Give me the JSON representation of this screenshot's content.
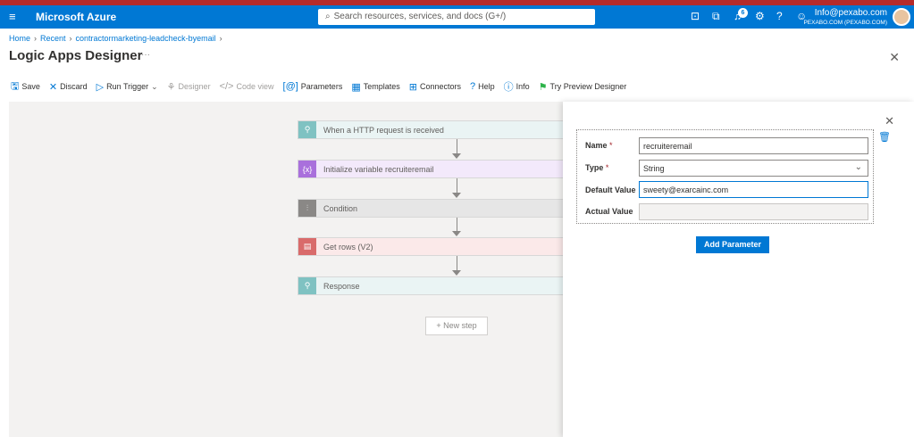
{
  "header": {
    "brand": "Microsoft Azure",
    "search_placeholder": "Search resources, services, and docs (G+/)",
    "notification_count": "6",
    "user_email": "Info@pexabo.com",
    "user_org": "PEXABO.COM (PEXABO.COM)"
  },
  "breadcrumb": {
    "items": [
      "Home",
      "Recent",
      "contractormarketing-leadcheck-byemail"
    ]
  },
  "page": {
    "title": "Logic Apps Designer",
    "more": "···"
  },
  "toolbar": {
    "save": "Save",
    "discard": "Discard",
    "run_trigger": "Run Trigger",
    "designer": "Designer",
    "code_view": "Code view",
    "parameters": "Parameters",
    "templates": "Templates",
    "connectors": "Connectors",
    "help": "Help",
    "info": "Info",
    "try_preview": "Try Preview Designer"
  },
  "workflow": {
    "steps": [
      {
        "label": "When a HTTP request is received",
        "icon": "http-request-icon",
        "color": "#7fc2c2",
        "bg": "#eaf4f4"
      },
      {
        "label": "Initialize variable recruiteremail",
        "icon": "variable-icon",
        "color": "#a970dc",
        "bg": "#f3e9fb"
      },
      {
        "label": "Condition",
        "icon": "condition-icon",
        "color": "#8a8886",
        "bg": "#e6e6e6"
      },
      {
        "label": "Get rows (V2)",
        "icon": "sql-rows-icon",
        "color": "#d96b6b",
        "bg": "#fbe9e9"
      },
      {
        "label": "Response",
        "icon": "response-icon",
        "color": "#7fc2c2",
        "bg": "#eaf4f4"
      }
    ],
    "new_step": "+ New step"
  },
  "param_panel": {
    "name_label": "Name",
    "name_value": "recruiteremail",
    "type_label": "Type",
    "type_value": "String",
    "default_label": "Default Value",
    "default_value": "sweety@exarcainc.com",
    "actual_label": "Actual Value",
    "actual_value": "",
    "required_mark": "*",
    "add_button": "Add Parameter"
  }
}
